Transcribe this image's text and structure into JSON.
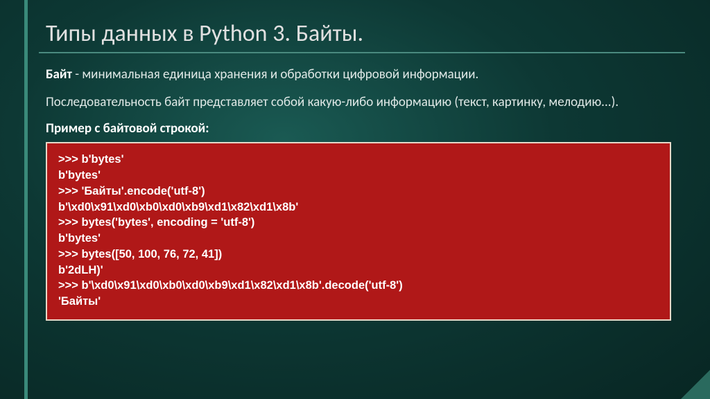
{
  "title": "Типы данных в Python 3. Байты.",
  "para1_bold": "Байт",
  "para1_rest": " - минимальная единица хранения и обработки цифровой информации.",
  "para2": "Последовательность байт представляет собой какую-либо информацию (текст, картинку, мелодию...).",
  "example_label": "Пример с байтовой строкой:",
  "code": ">>> b'bytes'\nb'bytes'\n>>> 'Байты'.encode('utf-8')\nb'\\xd0\\x91\\xd0\\xb0\\xd0\\xb9\\xd1\\x82\\xd1\\x8b'\n>>> bytes('bytes', encoding = 'utf-8')\nb'bytes'\n>>> bytes([50, 100, 76, 72, 41])\nb'2dLH)'\n>>> b'\\xd0\\x91\\xd0\\xb0\\xd0\\xb9\\xd1\\x82\\xd1\\x8b'.decode('utf-8')\n'Байты'"
}
